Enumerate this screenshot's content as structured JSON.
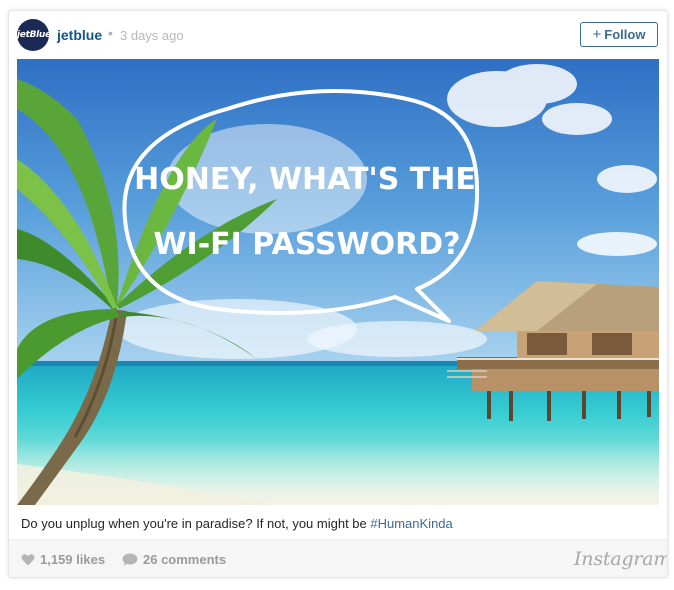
{
  "post": {
    "avatar_text": "jetBlue",
    "username": "jetblue",
    "separator": "•",
    "time": "3 days ago",
    "follow_label": "Follow",
    "follow_plus": "+",
    "image_text_line1": "HONEY, WHAT'S THE",
    "image_text_line2": "WI-FI PASSWORD?",
    "caption_text": "Do you unplug when you're in paradise? If not, you might be ",
    "hashtag": "#HumanKinda",
    "likes": "1,159 likes",
    "comments": "26 comments",
    "brand": "Instagram"
  },
  "icons": {
    "like": "heart-icon",
    "comment": "speech-bubble-icon"
  },
  "colors": {
    "username": "#125688",
    "link": "#3a6b93",
    "muted": "#9a9a9a",
    "footer_bg": "#f6f6f6"
  }
}
